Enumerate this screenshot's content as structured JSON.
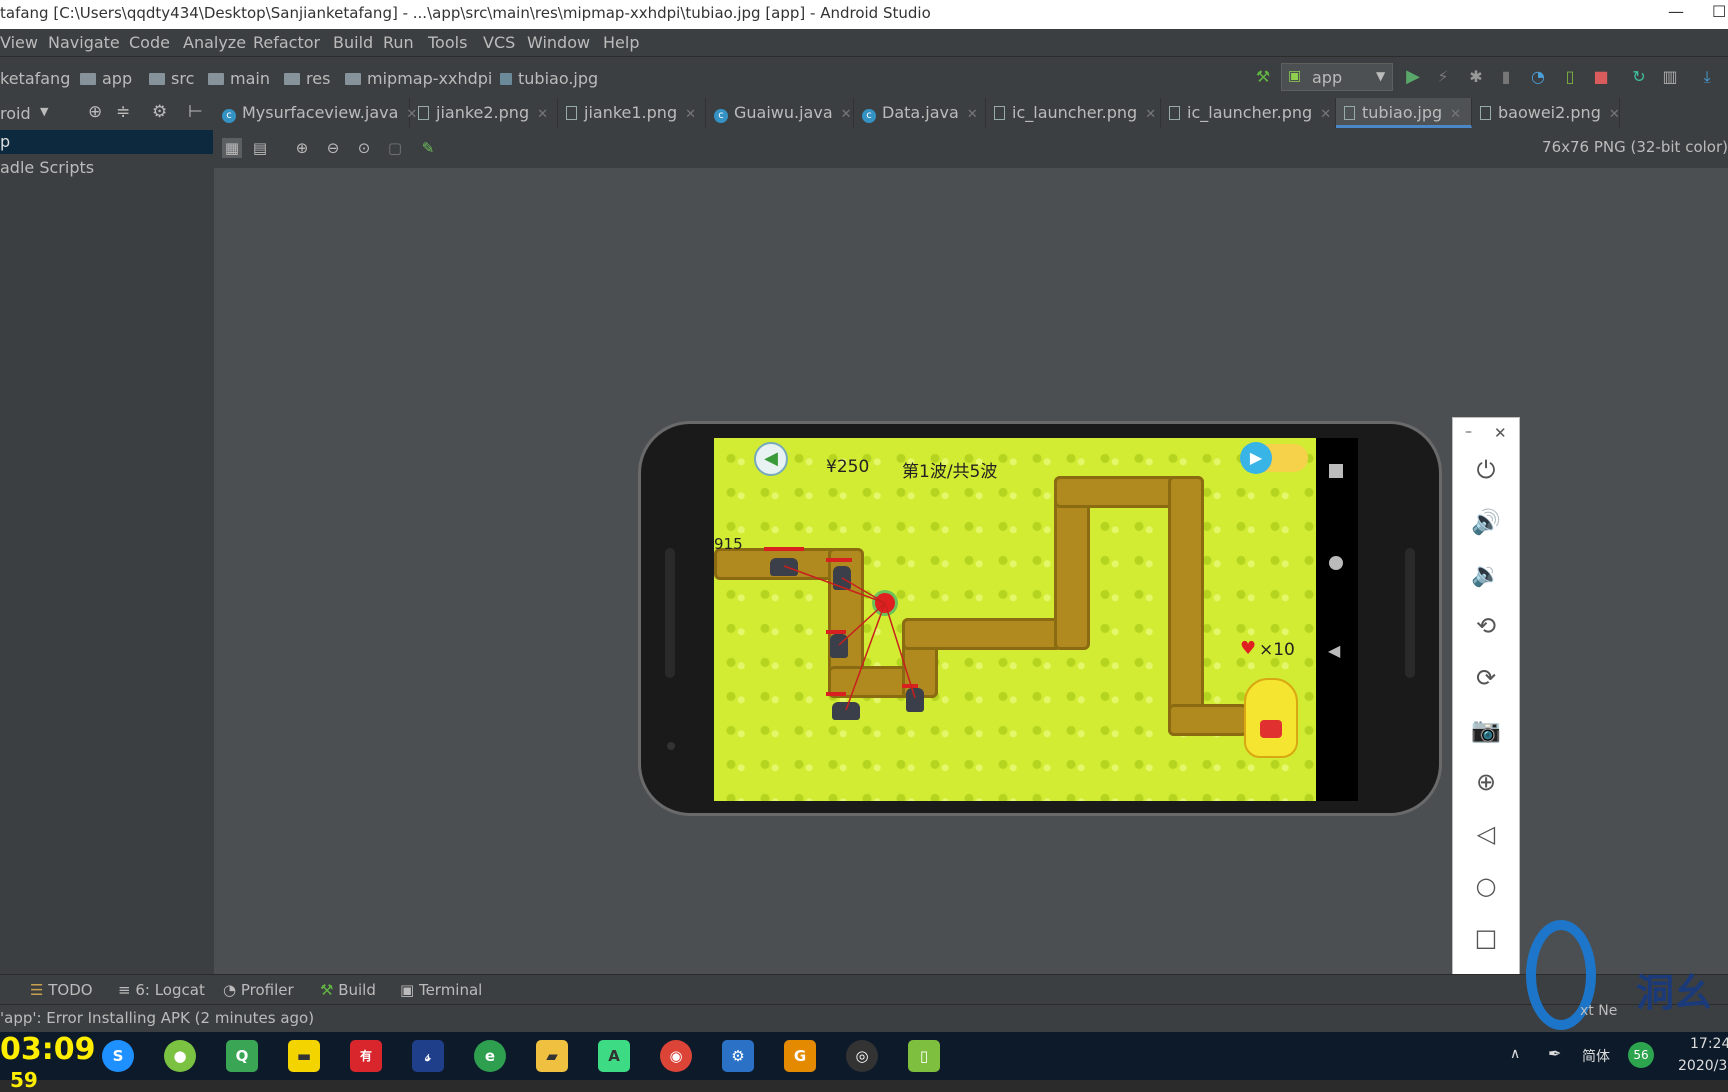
{
  "window": {
    "title": "tafang [C:\\Users\\qqdty434\\Desktop\\Sanjianketafang] - ...\\app\\src\\main\\res\\mipmap-xxhdpi\\tubiao.jpg [app] - Android Studio",
    "minimize": "—",
    "maximize": "☐"
  },
  "menu": [
    "View",
    "Navigate",
    "Code",
    "Analyze",
    "Refactor",
    "Build",
    "Run",
    "Tools",
    "VCS",
    "Window",
    "Help"
  ],
  "breadcrumb": [
    "ketafang",
    "app",
    "src",
    "main",
    "res",
    "mipmap-xxhdpi",
    "tubiao.jpg"
  ],
  "run_config": "app",
  "project_panel": {
    "view": "roid",
    "items": [
      "p",
      "adle Scripts"
    ]
  },
  "tabs": [
    {
      "label": "Mysurfaceview.java",
      "kind": "class"
    },
    {
      "label": "jianke2.png",
      "kind": "image"
    },
    {
      "label": "jianke1.png",
      "kind": "image"
    },
    {
      "label": "Guaiwu.java",
      "kind": "class"
    },
    {
      "label": "Data.java",
      "kind": "class"
    },
    {
      "label": "ic_launcher.png",
      "kind": "image"
    },
    {
      "label": "ic_launcher.png",
      "kind": "image"
    },
    {
      "label": "tubiao.jpg",
      "kind": "image",
      "active": true
    },
    {
      "label": "baowei2.png",
      "kind": "image"
    }
  ],
  "image_info": "76x76 PNG (32-bit color)",
  "game": {
    "money": "¥250",
    "wave": "第1波/共5波",
    "score": "915",
    "lives": "×10"
  },
  "tool_windows": [
    "TODO",
    "6: Logcat",
    "Profiler",
    "Build",
    "Terminal"
  ],
  "status": "'app': Error Installing APK (2 minutes ago)",
  "taskbar": {
    "clock_overlay": "03:09",
    "clock_overlay2": "59",
    "ime": "简体",
    "badge": "56",
    "time": "17:24",
    "date": "2020/3"
  },
  "watermark": "洞幺",
  "watermark_sub": "xt Ne"
}
